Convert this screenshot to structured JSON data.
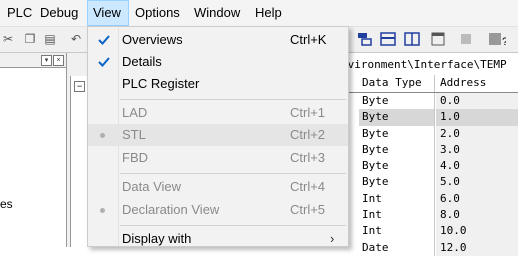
{
  "menubar": {
    "items": [
      "PLC",
      "Debug",
      "View",
      "Options",
      "Window",
      "Help"
    ]
  },
  "view_menu": {
    "items": [
      {
        "label": "Overviews",
        "shortcut": "Ctrl+K",
        "checked": true,
        "enabled": true
      },
      {
        "label": "Details",
        "shortcut": "",
        "checked": true,
        "enabled": true
      },
      {
        "label": "PLC Register",
        "shortcut": "",
        "checked": false,
        "enabled": true
      },
      {
        "label": "LAD",
        "shortcut": "Ctrl+1",
        "checked": false,
        "enabled": false
      },
      {
        "label": "STL",
        "shortcut": "Ctrl+2",
        "checked": false,
        "enabled": false,
        "bullet": true
      },
      {
        "label": "FBD",
        "shortcut": "Ctrl+3",
        "checked": false,
        "enabled": false
      },
      {
        "label": "Data View",
        "shortcut": "Ctrl+4",
        "checked": false,
        "enabled": false
      },
      {
        "label": "Declaration View",
        "shortcut": "Ctrl+5",
        "checked": false,
        "enabled": false,
        "bullet": true
      },
      {
        "label": "Display with",
        "shortcut": "",
        "submenu": true,
        "enabled": true
      }
    ]
  },
  "path": "nvironment\\Interface\\TEMP",
  "table": {
    "headers": {
      "type": "Data Type",
      "address": "Address"
    },
    "rows": [
      {
        "type": "Byte",
        "address": "0.0"
      },
      {
        "type": "Byte",
        "address": "1.0",
        "selected": true
      },
      {
        "type": "Byte",
        "address": "2.0"
      },
      {
        "type": "Byte",
        "address": "3.0"
      },
      {
        "type": "Byte",
        "address": "4.0"
      },
      {
        "type": "Byte",
        "address": "5.0"
      },
      {
        "type": "Int",
        "address": "6.0"
      },
      {
        "type": "Int",
        "address": "8.0"
      },
      {
        "type": "Int",
        "address": "10.0"
      },
      {
        "type": "Date",
        "address": "12.0"
      }
    ]
  },
  "left_fragment": "es"
}
